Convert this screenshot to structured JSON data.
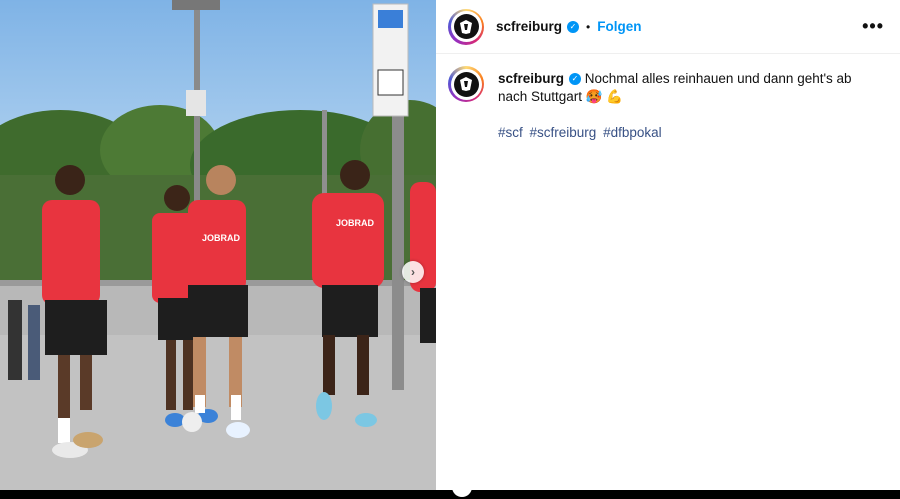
{
  "post": {
    "username": "scfreiburg",
    "follow_label": "Folgen",
    "separator": "•",
    "more_label": "•••",
    "caption_text": "Nochmal alles reinhauen und dann geht's ab nach Stuttgart 🥵 💪",
    "hashtags": [
      "#scf",
      "#scfreiburg",
      "#dfbpokal"
    ]
  },
  "photo": {
    "shirt_text": "JOBRAD",
    "next_label": "›"
  },
  "colors": {
    "accent": "#0095f6",
    "shirt_red": "#e8343f",
    "shorts": "#1e1e1e"
  }
}
